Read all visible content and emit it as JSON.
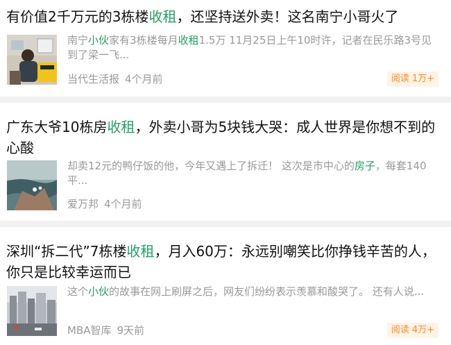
{
  "articles": [
    {
      "title_parts": [
        "有价值2千万元的3栋楼",
        "收租",
        "，还坚持送外卖！这名南宁小哥火了"
      ],
      "snippet_parts": [
        "南宁",
        "小伙",
        "家有3栋楼每月",
        "收租",
        "1.5万 11月25日上午10时许，记者在民乐路3号见到了梁一飞..."
      ],
      "source": "当代生活报",
      "time": "4个月前",
      "reads": "阅读 1万+"
    },
    {
      "title_parts": [
        "广东大爷10栋房",
        "收租",
        "，外卖小哥为5块钱大哭：成人世界是你想不到的心酸"
      ],
      "snippet_parts": [
        "却卖12元的鸭仔饭的他，今年又遇上了拆迁！ 这次是市中心的",
        "房子",
        "，每套140平..."
      ],
      "source": "爱万邦",
      "time": "4个月前"
    },
    {
      "title_parts": [
        "深圳“拆二代”7栋楼",
        "收租",
        "，月入60万：永远别嘲笑比你挣钱辛苦的人，你只是比较幸运而已"
      ],
      "snippet_parts": [
        "这个",
        "小伙",
        "的故事在网上刷屏之后，网友们纷纷表示羡慕和酸哭了。 还有人说..."
      ],
      "source": "MBA智库",
      "time": "9天前",
      "reads": "阅读 4万+"
    }
  ]
}
